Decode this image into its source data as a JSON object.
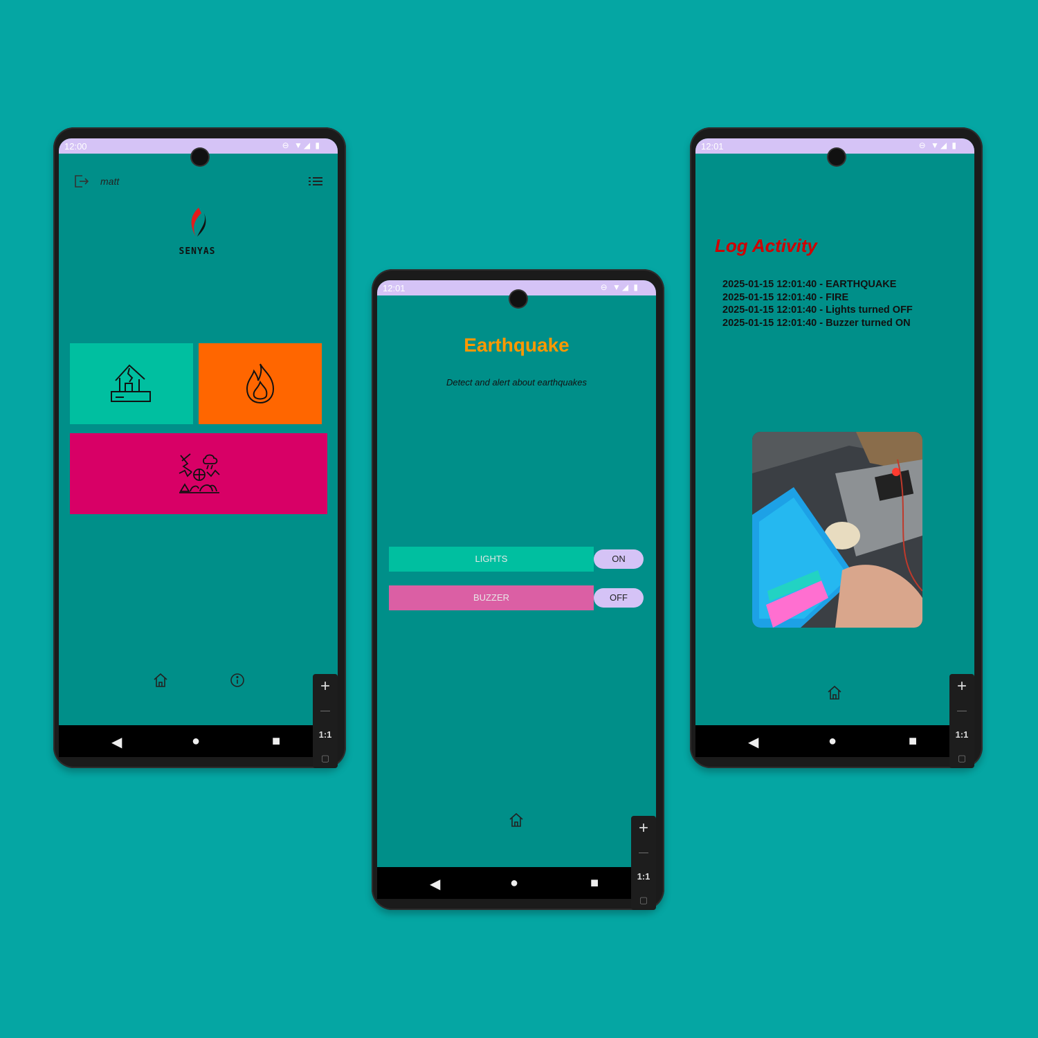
{
  "phone_home": {
    "status_time": "12:00",
    "status_icons": "⊖ ▼◢ ▮",
    "username": "matt",
    "logo_text": "SENYAS",
    "tiles": [
      {
        "icon": "earthquake-house-icon",
        "color": "#00bfa0"
      },
      {
        "icon": "fire-icon",
        "color": "#ff6600"
      },
      {
        "icon": "multi-hazard-icon",
        "color": "#d80066"
      }
    ],
    "zoom": {
      "plus": "+",
      "minus": "—",
      "ratio": "1:1"
    }
  },
  "phone_detail": {
    "status_time": "12:01",
    "status_icons": "⊖ ▼◢ ▮",
    "title": "Earthquake",
    "subtitle": "Detect and alert about earthquakes",
    "lights": {
      "label": "LIGHTS",
      "state": "ON"
    },
    "buzzer": {
      "label": "BUZZER",
      "state": "OFF"
    },
    "zoom": {
      "plus": "+",
      "minus": "—",
      "ratio": "1:1"
    }
  },
  "phone_log": {
    "status_time": "12:01",
    "status_icons": "⊖ ▼◢ ▮",
    "title": "Log Activity",
    "entries": [
      "2025-01-15 12:01:40 - EARTHQUAKE",
      "2025-01-15 12:01:40 - FIRE",
      "2025-01-15 12:01:40 - Lights turned OFF",
      "2025-01-15 12:01:40 - Buzzer turned ON"
    ],
    "zoom": {
      "plus": "+",
      "minus": "—",
      "ratio": "1:1"
    }
  },
  "colors": {
    "background": "#05a6a3",
    "screen": "#008f89",
    "status_bar": "#d5c3f6",
    "title_orange": "#ff9800",
    "log_title_red": "#d00000"
  }
}
